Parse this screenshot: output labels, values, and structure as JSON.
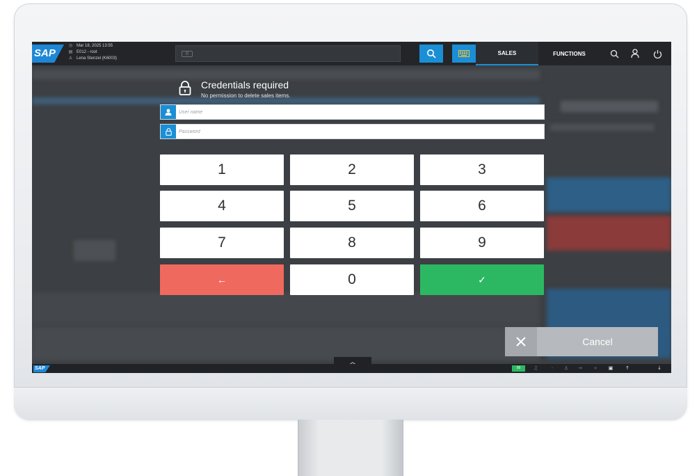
{
  "header": {
    "logo_text": "SAP",
    "date_time": "Mar 18, 2025 13:55",
    "terminal": "E012 - root",
    "user": "Lena Stenzel (K6003)",
    "input_badge": "|||",
    "tabs": [
      {
        "label": "SALES",
        "active": true
      },
      {
        "label": "FUNCTIONS",
        "active": false
      }
    ],
    "icons": [
      "search-icon",
      "keyboard-icon",
      "search-icon",
      "user-icon",
      "power-icon"
    ]
  },
  "dialog": {
    "title": "Credentials required",
    "subtitle": "No permission to delete sales items.",
    "username_placeholder": "User name",
    "password_placeholder": "Password",
    "keypad": [
      "1",
      "2",
      "3",
      "4",
      "5",
      "6",
      "7",
      "8",
      "9",
      "←",
      "0",
      "✓"
    ],
    "cancel_label": "Cancel"
  },
  "footer": {
    "logo_text": "SAP",
    "status_count": "99"
  },
  "colors": {
    "accent": "#1a8fd6",
    "backspace": "#f0695f",
    "confirm": "#2cb862",
    "overlay": "#3c3f43"
  }
}
